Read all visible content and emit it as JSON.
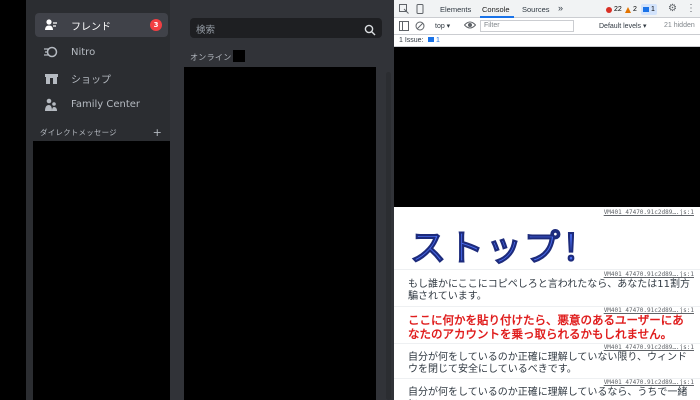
{
  "sidebar": {
    "items": [
      {
        "label": "フレンド",
        "icon": "friends-icon",
        "active": true,
        "badge": "3"
      },
      {
        "label": "Nitro",
        "icon": "nitro-icon"
      },
      {
        "label": "ショップ",
        "icon": "shop-icon"
      },
      {
        "label": "Family Center",
        "icon": "family-icon"
      }
    ],
    "dm_header": "ダイレクトメッセージ",
    "dm_add": "+"
  },
  "main": {
    "search_placeholder": "検索",
    "online_label": "オンライン —"
  },
  "devtools": {
    "tabs": [
      "Elements",
      "Console",
      "Sources"
    ],
    "more": "»",
    "errors": "22",
    "warnings": "2",
    "infos": "1",
    "context": "top",
    "filter_placeholder": "Filter",
    "levels": "Default levels",
    "hidden": "21 hidden",
    "issues": "1 Issue:",
    "issues_count": "1",
    "source_link": "VM401 47470.91c2d89….js:1",
    "messages": {
      "title": "ストップ！",
      "msg1": "もし誰かにここにコピペしろと言われたなら、あなたは11割方騙されています。",
      "warning": "ここに何かを貼り付けたら、悪意のあるユーザーにあなたのアカウントを乗っ取られるかもしれません。",
      "msg2": "自分が何をしているのか正確に理解していない限り、ウィンドウを閉じて安全にしているべきです。",
      "msg3": "自分が何をしているのか正確に理解しているなら、うちで一緒に"
    }
  }
}
